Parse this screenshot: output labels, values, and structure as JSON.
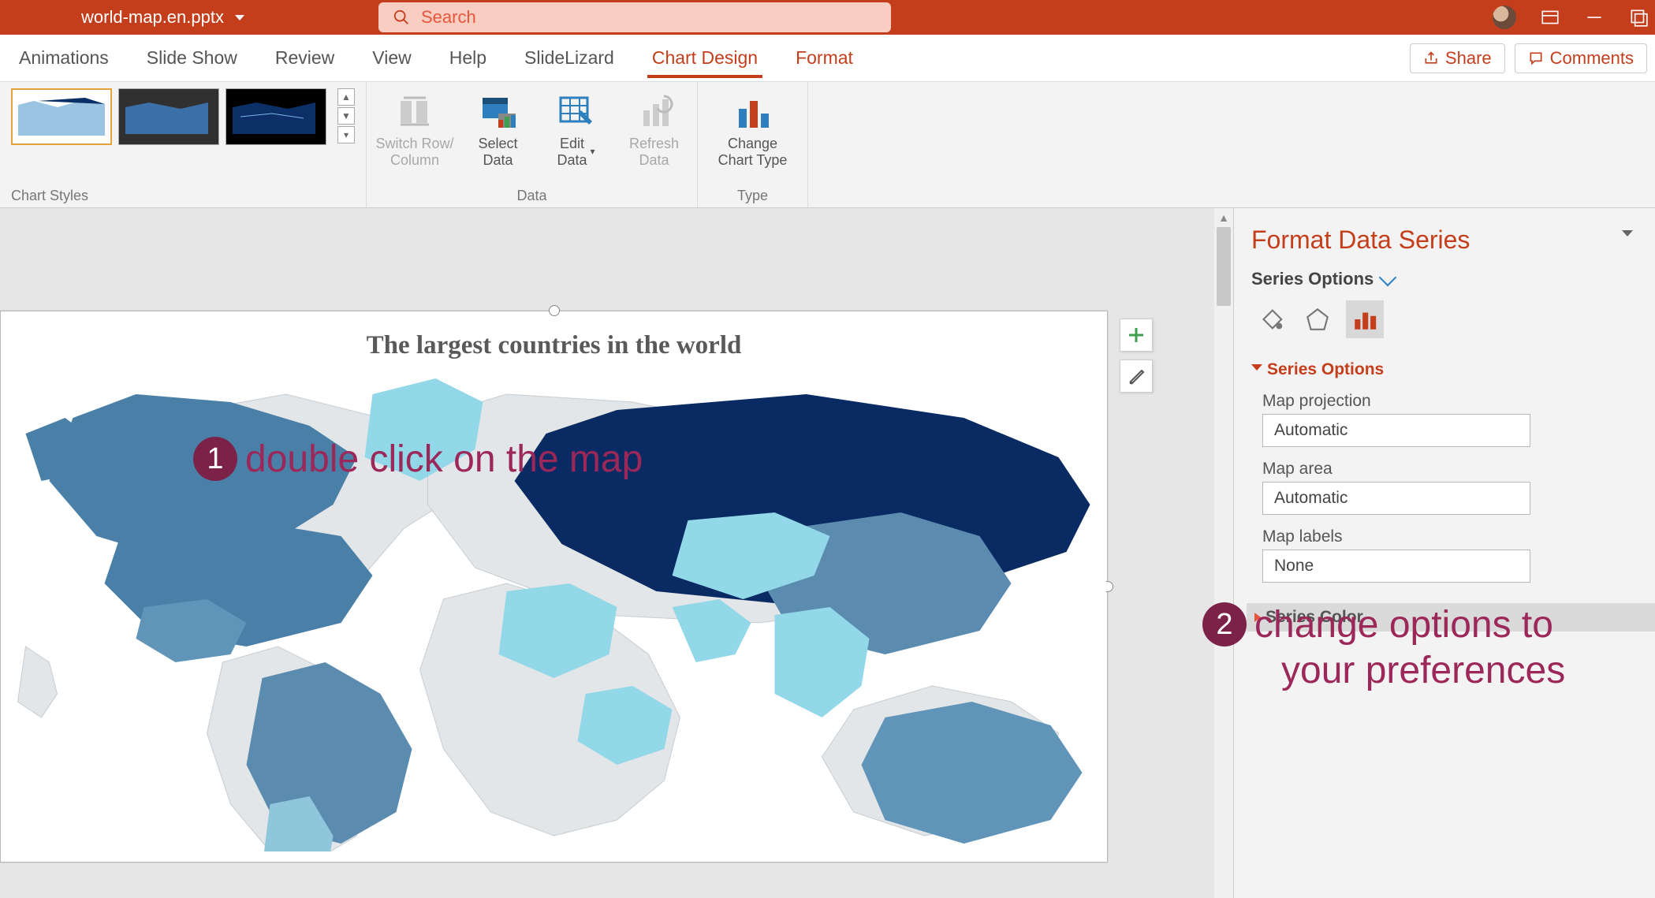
{
  "titlebar": {
    "filename": "world-map.en.pptx",
    "search_placeholder": "Search"
  },
  "tabs": [
    "Animations",
    "Slide Show",
    "Review",
    "View",
    "Help",
    "SlideLizard",
    "Chart Design",
    "Format"
  ],
  "active_tab": "Chart Design",
  "right_buttons": {
    "share": "Share",
    "comments": "Comments"
  },
  "ribbon": {
    "chart_styles_label": "Chart Styles",
    "data_label": "Data",
    "type_label": "Type",
    "switch_rc": "Switch Row/\nColumn",
    "select_data": "Select\nData",
    "edit_data": "Edit\nData",
    "refresh_data": "Refresh\nData",
    "change_type": "Change\nChart Type"
  },
  "chart_title": "The largest countries in the world",
  "format_pane": {
    "title": "Format Data Series",
    "subtitle": "Series Options",
    "series_options_hd": "Series Options",
    "series_color_hd": "Series Color",
    "map_projection_label": "Map projection",
    "map_projection_value": "Automatic",
    "map_area_label": "Map area",
    "map_area_value": "Automatic",
    "map_labels_label": "Map labels",
    "map_labels_value": "None"
  },
  "annotations": {
    "a1": "double click on the map",
    "a2_l1": "change options to",
    "a2_l2": "your preferences"
  }
}
